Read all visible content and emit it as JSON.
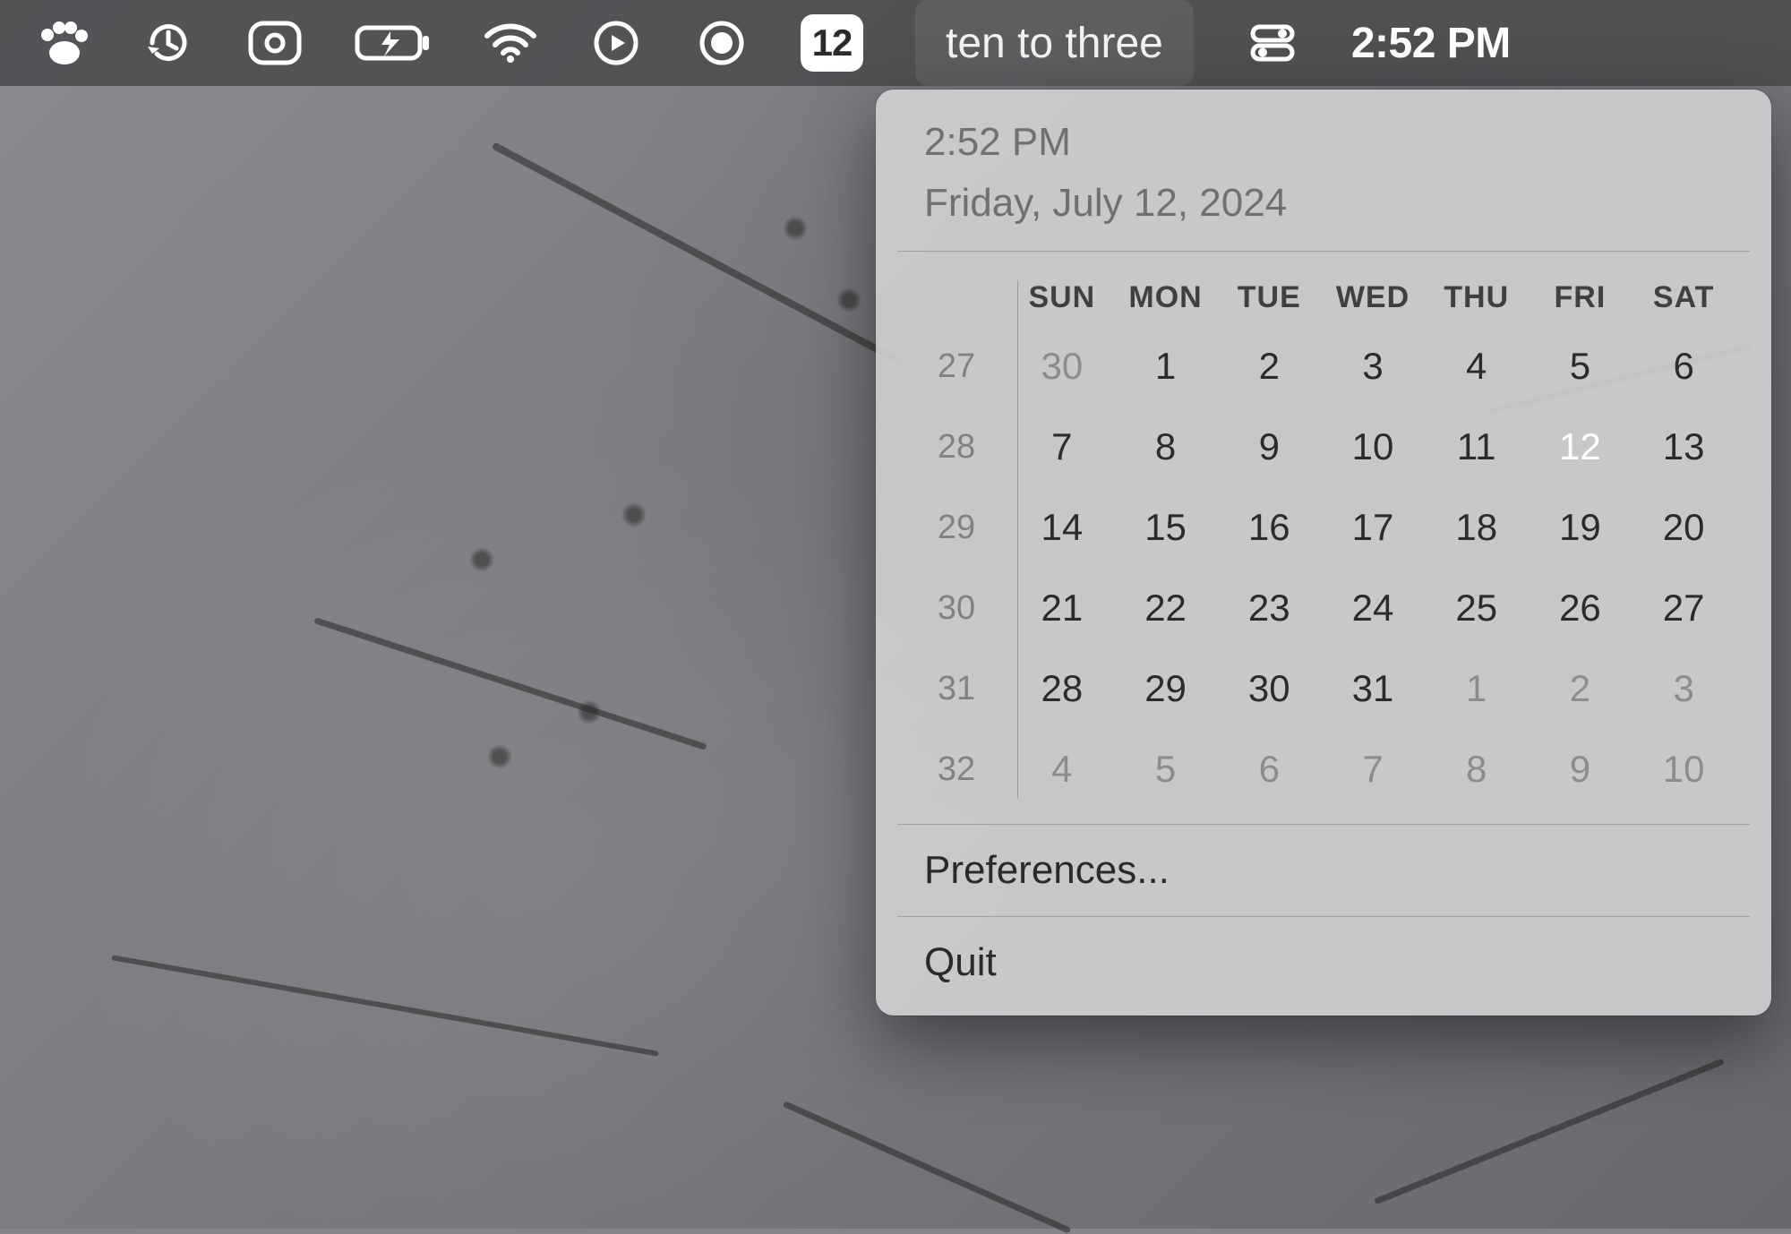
{
  "menubar": {
    "date_chip": "12",
    "fuzzy_time": "ten to three",
    "clock": "2:52 PM"
  },
  "panel": {
    "time": "2:52 PM",
    "date": "Friday, July 12, 2024",
    "preferences_label": "Preferences...",
    "quit_label": "Quit"
  },
  "calendar": {
    "today": 12,
    "dow": [
      "SUN",
      "MON",
      "TUE",
      "WED",
      "THU",
      "FRI",
      "SAT"
    ],
    "weeks": [
      {
        "num": "27",
        "days": [
          {
            "n": "30",
            "dim": true
          },
          {
            "n": "1"
          },
          {
            "n": "2"
          },
          {
            "n": "3"
          },
          {
            "n": "4"
          },
          {
            "n": "5"
          },
          {
            "n": "6"
          }
        ]
      },
      {
        "num": "28",
        "days": [
          {
            "n": "7"
          },
          {
            "n": "8"
          },
          {
            "n": "9"
          },
          {
            "n": "10"
          },
          {
            "n": "11"
          },
          {
            "n": "12",
            "today": true
          },
          {
            "n": "13"
          }
        ]
      },
      {
        "num": "29",
        "days": [
          {
            "n": "14"
          },
          {
            "n": "15"
          },
          {
            "n": "16"
          },
          {
            "n": "17"
          },
          {
            "n": "18"
          },
          {
            "n": "19"
          },
          {
            "n": "20"
          }
        ]
      },
      {
        "num": "30",
        "days": [
          {
            "n": "21"
          },
          {
            "n": "22"
          },
          {
            "n": "23"
          },
          {
            "n": "24"
          },
          {
            "n": "25"
          },
          {
            "n": "26"
          },
          {
            "n": "27"
          }
        ]
      },
      {
        "num": "31",
        "days": [
          {
            "n": "28"
          },
          {
            "n": "29"
          },
          {
            "n": "30"
          },
          {
            "n": "31"
          },
          {
            "n": "1",
            "dim": true
          },
          {
            "n": "2",
            "dim": true
          },
          {
            "n": "3",
            "dim": true
          }
        ]
      },
      {
        "num": "32",
        "days": [
          {
            "n": "4",
            "dim": true
          },
          {
            "n": "5",
            "dim": true
          },
          {
            "n": "6",
            "dim": true
          },
          {
            "n": "7",
            "dim": true
          },
          {
            "n": "8",
            "dim": true
          },
          {
            "n": "9",
            "dim": true
          },
          {
            "n": "10",
            "dim": true
          }
        ]
      }
    ]
  }
}
